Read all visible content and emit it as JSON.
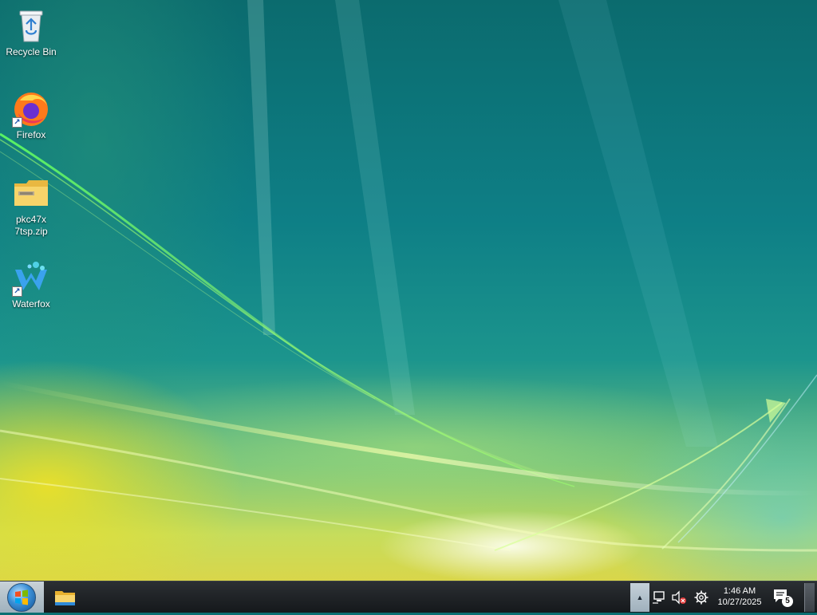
{
  "desktop": {
    "icons": [
      {
        "label": "Recycle Bin",
        "icon": "recycle-bin-icon"
      },
      {
        "label": "Firefox",
        "icon": "firefox-icon"
      },
      {
        "label_line1": "pkc47x",
        "label_line2": "7tsp.zip",
        "icon": "zip-folder-icon"
      },
      {
        "label": "Waterfox",
        "icon": "waterfox-icon"
      }
    ]
  },
  "taskbar": {
    "start_button": "start-orb-icon",
    "pinned": [
      {
        "icon": "file-explorer-icon"
      }
    ],
    "tray": {
      "expand_glyph": "▲",
      "network_icon": "network-icon",
      "volume_icon": "volume-muted-icon",
      "settings_icon": "settings-gear-icon",
      "time": "1:46 AM",
      "date": "10/27/2025",
      "notification_count": "5"
    }
  }
}
